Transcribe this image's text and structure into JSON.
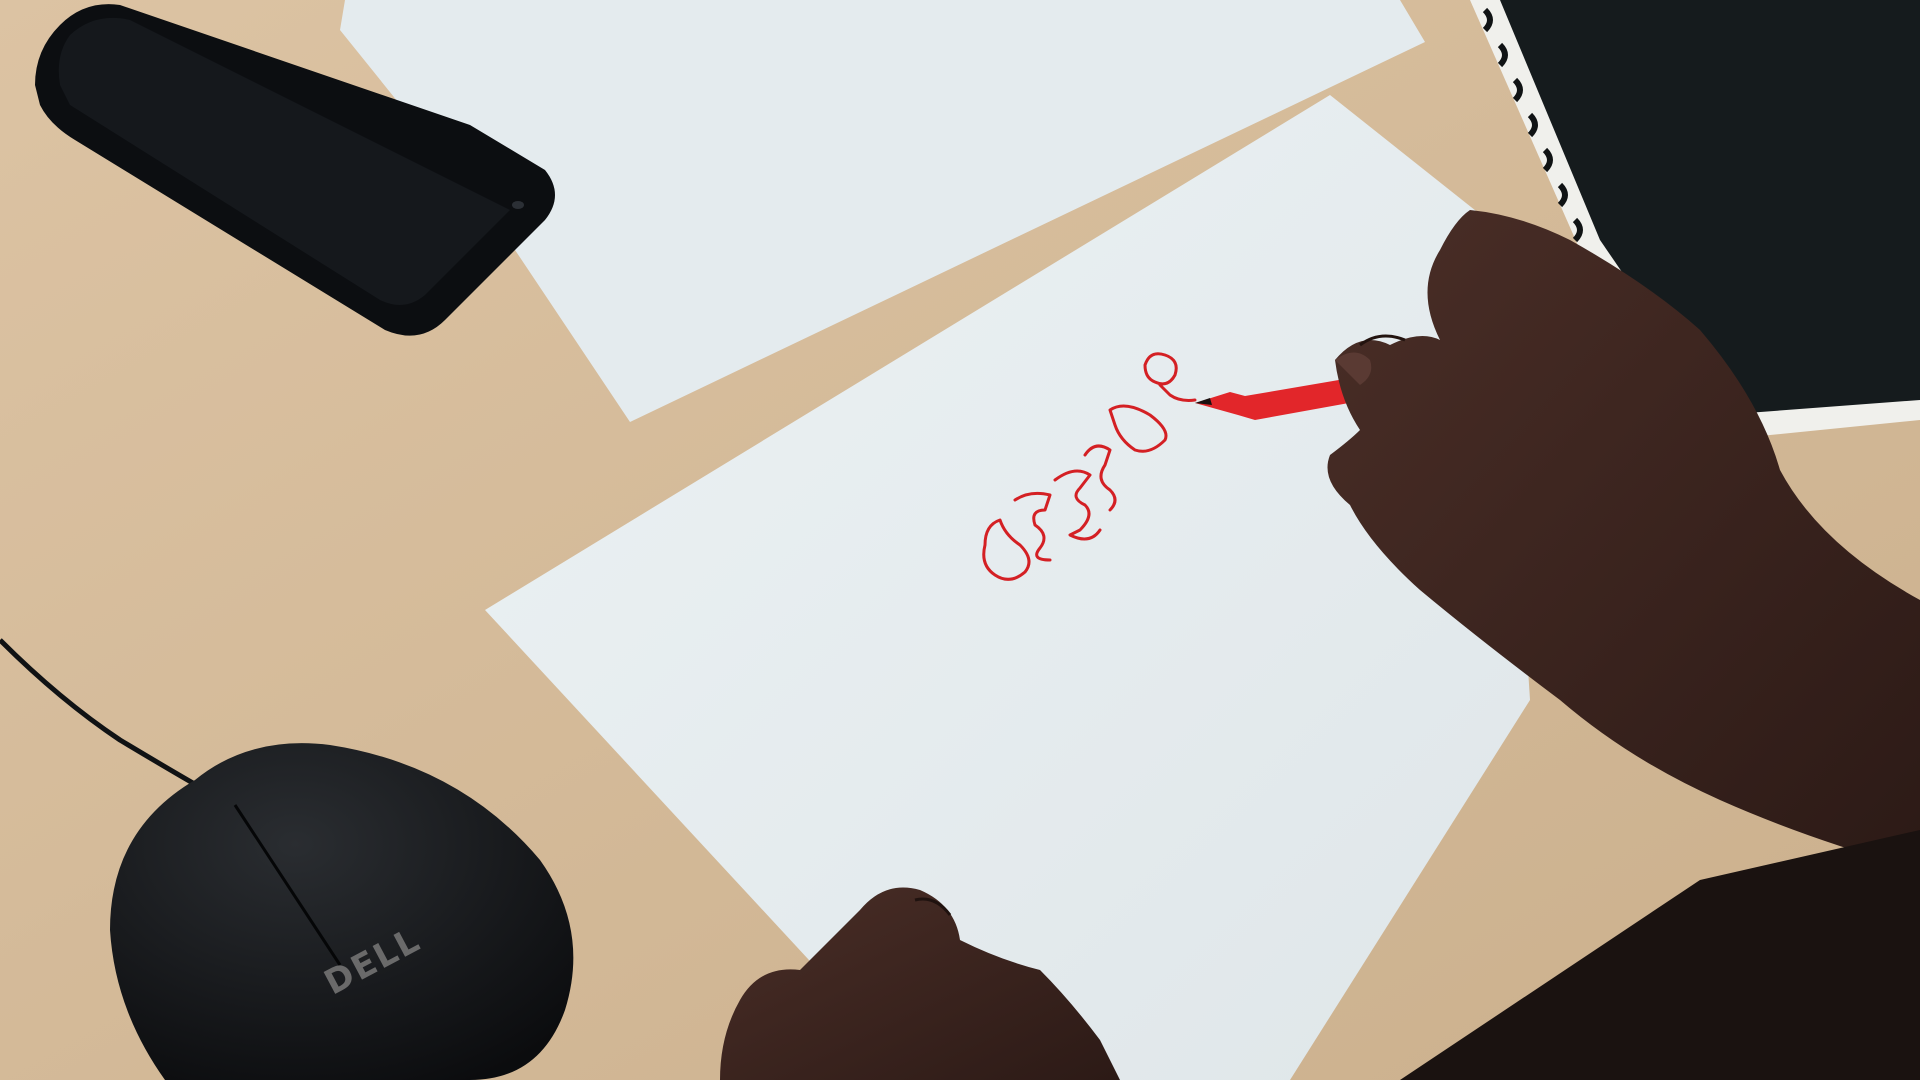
{
  "scene": {
    "description_type": "photo",
    "objects": [
      {
        "name": "table",
        "color": "#d9bf9e"
      },
      {
        "name": "paper-back",
        "color": "#e5ecef"
      },
      {
        "name": "paper-front",
        "color": "#e9eff2"
      },
      {
        "name": "smartphone",
        "color": "#0d0f12"
      },
      {
        "name": "notebook",
        "color": "#1a1f22"
      },
      {
        "name": "mouse",
        "color": "#121416"
      },
      {
        "name": "red-marker",
        "color": "#e2262a"
      },
      {
        "name": "hand-writing",
        "color": "#3b2520"
      },
      {
        "name": "hand-resting",
        "color": "#3b2520"
      },
      {
        "name": "red-doodle",
        "color": "#d42024"
      }
    ]
  },
  "mouse": {
    "brand_text": "DELL"
  }
}
